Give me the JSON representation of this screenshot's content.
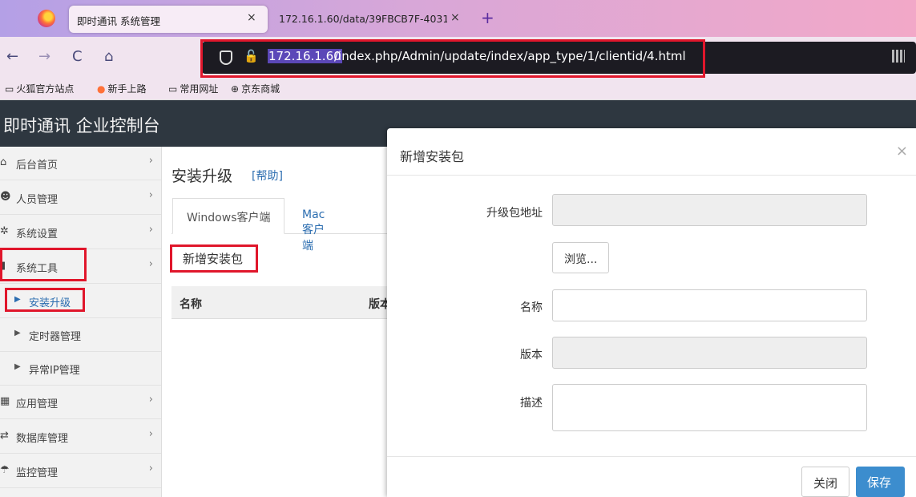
{
  "browser": {
    "active_tab_title": "即时通讯 系统管理",
    "inactive_tab_title": "172.16.1.60/data/39FBCB7F-4031",
    "close_glyph": "×",
    "new_tab_glyph": "+",
    "url_host": "172.16.1.60",
    "url_path": "/index.php/Admin/update/index/app_type/1/clientid/4.html",
    "nav_back": "←",
    "nav_forward": "→",
    "nav_reload": "C",
    "nav_home": "⌂",
    "bookmarks": [
      {
        "label": "火狐官方站点",
        "icon": "folder-icon"
      },
      {
        "label": "新手上路",
        "icon": "firefox-icon"
      },
      {
        "label": "常用网址",
        "icon": "folder-icon"
      },
      {
        "label": "京东商城",
        "icon": "globe-icon"
      }
    ]
  },
  "app": {
    "title": "即时通讯 企业控制台"
  },
  "sidebar": {
    "items": [
      {
        "label": "后台首页",
        "icon": "home-icon",
        "chev": "›"
      },
      {
        "label": "人员管理",
        "icon": "users-icon",
        "chev": "›"
      },
      {
        "label": "系统设置",
        "icon": "settings-icon",
        "chev": "›"
      },
      {
        "label": "系统工具",
        "icon": "toolbox-icon",
        "chev": "›"
      }
    ],
    "subitems": [
      {
        "label": "安装升级",
        "active": true
      },
      {
        "label": "定时器管理",
        "active": false
      },
      {
        "label": "异常IP管理",
        "active": false
      }
    ],
    "items2": [
      {
        "label": "应用管理",
        "icon": "grid-icon",
        "chev": "›"
      },
      {
        "label": "数据库管理",
        "icon": "database-icon",
        "chev": "›"
      },
      {
        "label": "监控管理",
        "icon": "umbrella-icon",
        "chev": "›"
      }
    ]
  },
  "main": {
    "page_title": "安装升级",
    "help_link": "[帮助]",
    "tabs": [
      {
        "label": "Windows客户端",
        "active": true
      },
      {
        "label": "Mac客户端",
        "active": false
      }
    ],
    "add_button": "新增安装包",
    "columns": [
      "名称",
      "版本"
    ]
  },
  "modal": {
    "title": "新增安装包",
    "close_glyph": "×",
    "fields": {
      "package_url_label": "升级包地址",
      "package_url_value": "",
      "browse_label": "浏览...",
      "name_label": "名称",
      "name_value": "",
      "version_label": "版本",
      "version_value": "",
      "description_label": "描述",
      "description_value": ""
    },
    "close_button": "关闭",
    "save_button": "保存"
  },
  "colors": {
    "highlight_red": "#e0162b",
    "link_blue": "#2b6db0",
    "save_blue": "#3c8dce",
    "header_dark": "#2e3740"
  }
}
